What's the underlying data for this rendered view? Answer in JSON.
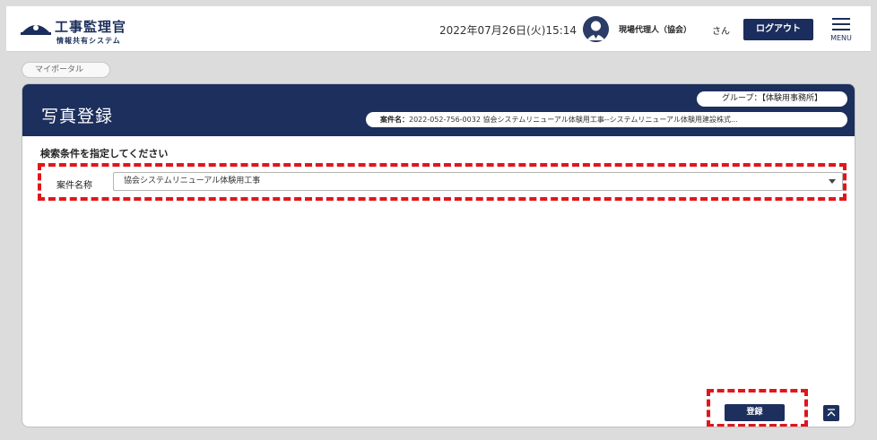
{
  "header": {
    "app_title": "工事監理官",
    "app_subtitle": "情報共有システム",
    "datetime": "2022年07月26日(火)15:14",
    "user_name": "現場代理人（協会）",
    "user_suffix": "さん",
    "logout_label": "ログアウト",
    "menu_label": "MENU"
  },
  "breadcrumb": {
    "label": "マイポータル"
  },
  "page": {
    "title": "写真登録",
    "group": "グループ：【体験用事務所】",
    "project_label": "案件名：",
    "project_value": "2022-052-756-0032 協会システムリニューアル体験用工事--システムリニューアル体験用建設株式..."
  },
  "search": {
    "heading": "検索条件を指定してください",
    "field_label": "案件名称",
    "selected_value": "協会システムリニューアル体験用工事"
  },
  "actions": {
    "register_label": "登録"
  },
  "colors": {
    "navy": "#1c2f5d",
    "highlight_red": "#e0161b"
  }
}
